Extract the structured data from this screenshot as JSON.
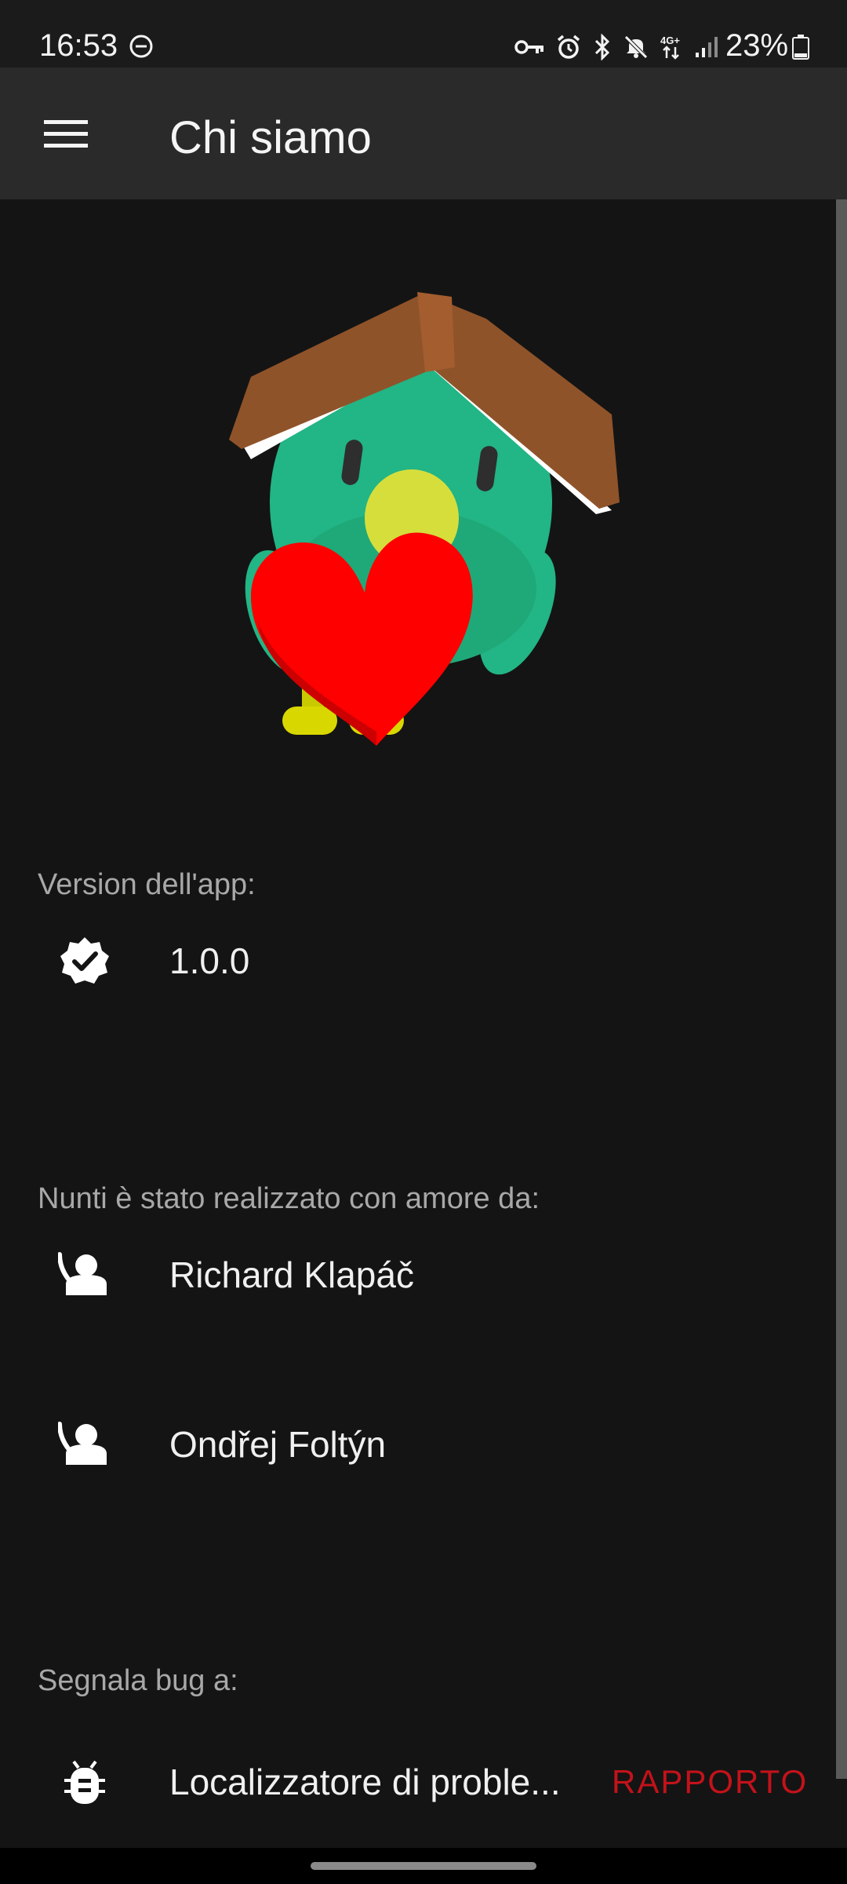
{
  "status_bar": {
    "time": "16:53",
    "battery": "23%",
    "icons": [
      "do-not-disturb-icon",
      "vpn-key-icon",
      "alarm-icon",
      "bluetooth-icon",
      "mute-icon",
      "4g-plus-icon",
      "signal-icon",
      "battery-icon"
    ]
  },
  "app_bar": {
    "title": "Chi siamo",
    "menu_icon": "menu-icon"
  },
  "sections": {
    "version_label": "Version dell'app:",
    "version_value": "1.0.0",
    "authors_label": "Nunti è stato realizzato con amore da:",
    "authors": [
      "Richard Klapáč",
      "Ondřej Foltýn"
    ],
    "bugs_label": "Segnala bug a:",
    "bug_tracker_label": "Localizzatore di proble...",
    "report_button": "RAPPORTO"
  },
  "colors": {
    "background": "#141414",
    "app_bar": "#2a2a2a",
    "accent_red": "#c3121a",
    "mascot_green": "#22b585",
    "roof_brown": "#8f532a",
    "heart_red": "#ff0000"
  }
}
